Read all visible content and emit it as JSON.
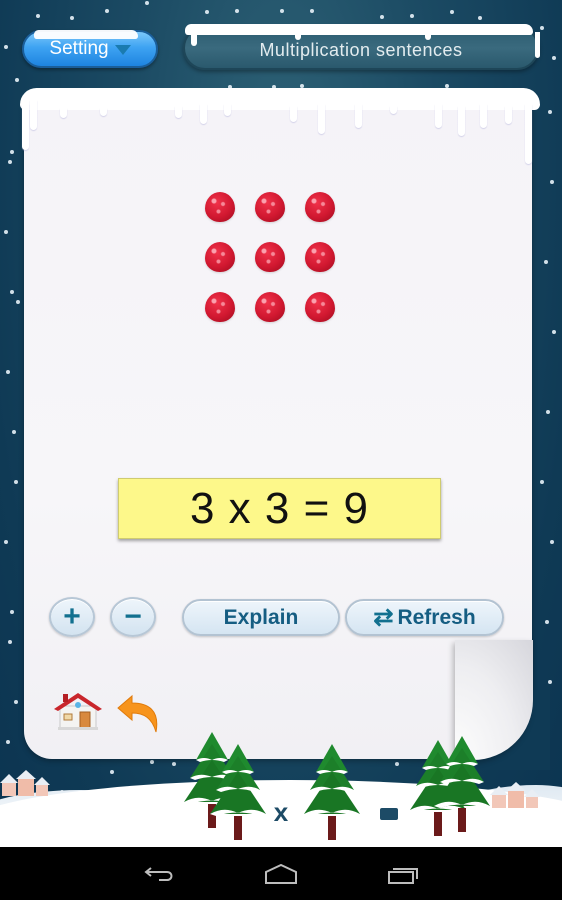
{
  "header": {
    "setting_label": "Setting",
    "title": "Multiplication sentences"
  },
  "main": {
    "item_icon": "raspberry-icon",
    "grid": {
      "rows": 3,
      "columns": 3,
      "count": 9
    },
    "equation": "3 x 3 = 9",
    "colors": {
      "equation_bg": "#fdf88a",
      "button_text": "#155d82",
      "setting_button": "#3ea3f2",
      "background": "#0f3a55"
    }
  },
  "controls": {
    "plus_label": "+",
    "minus_label": "−",
    "explain_label": "Explain",
    "refresh_label": "Refresh",
    "refresh_icon": "refresh-icon",
    "home_icon": "home-icon",
    "back_icon": "undo-arrow-icon"
  },
  "scenery": {
    "close_glyph": "x",
    "minimize_icon": "minimize-icon"
  },
  "system_nav": {
    "back": "back-icon",
    "home": "home-icon",
    "recents": "recent-apps-icon"
  }
}
